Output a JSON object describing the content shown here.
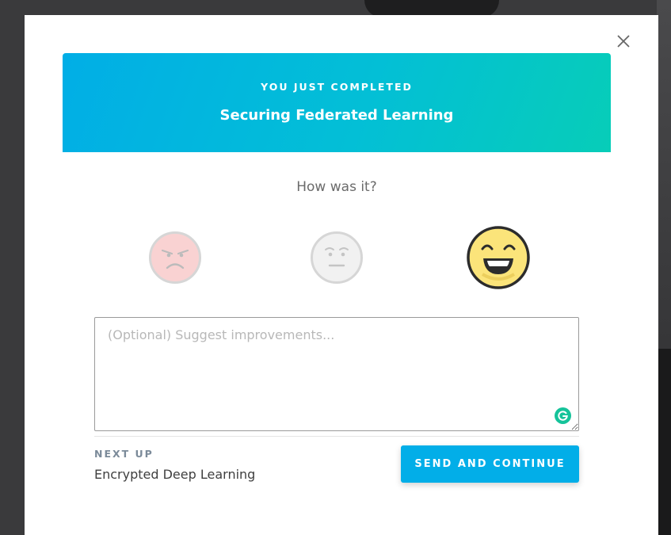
{
  "modal": {
    "close_icon": "close-icon",
    "banner": {
      "kicker": "YOU JUST COMPLETED",
      "title": "Securing Federated Learning"
    },
    "rating": {
      "question": "How was it?",
      "options": [
        {
          "icon": "sad-face-icon",
          "selected": false
        },
        {
          "icon": "neutral-face-icon",
          "selected": false
        },
        {
          "icon": "happy-face-icon",
          "selected": true
        }
      ]
    },
    "feedback": {
      "value": "",
      "placeholder": "(Optional) Suggest improvements..."
    },
    "next_up": {
      "label": "NEXT UP",
      "title": "Encrypted Deep Learning"
    },
    "send_button_label": "SEND AND CONTINUE",
    "colors": {
      "banner_start": "#01aee6",
      "banner_end": "#07cdb8",
      "button": "#02aee8",
      "happy_face": "#fbe47a",
      "sad_face": "#f9d2d2",
      "grammarly": "#15c39a"
    }
  }
}
